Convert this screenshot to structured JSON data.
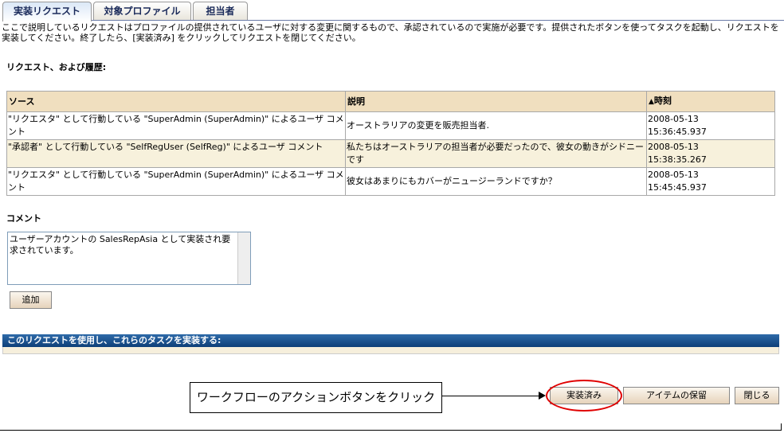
{
  "tabs": [
    {
      "label": "実装リクエスト"
    },
    {
      "label": "対象プロファイル"
    },
    {
      "label": "担当者"
    }
  ],
  "description": "ここで説明しているリクエストはプロファイルの提供されているユーザに対する変更に関するもので、承認されているので実施が必要です。提供されたボタンを使ってタスクを起動し、リクエストを実装してください。終了したら、[実装済み] をクリックしてリクエストを閉じてください。",
  "history_heading": "リクエスト、および履歴:",
  "table": {
    "headers": [
      "ソース",
      "説明",
      "時刻"
    ],
    "sort_icon": "▲",
    "rows": [
      {
        "source": "\"リクエスタ\" として行動している \"SuperAdmin (SuperAdmin)\" によるユーザ コメント",
        "desc": "オーストラリアの変更を販売担当者.",
        "date": "2008-05-13",
        "time": "15:36:45.937"
      },
      {
        "source": "\"承認者\" として行動している \"SelfRegUser (SelfReg)\" によるユーザ コメント",
        "desc": "私たちはオーストラリアの担当者が必要だったので、彼女の動きがシドニーです",
        "date": "2008-05-13",
        "time": "15:38:35.267"
      },
      {
        "source": "\"リクエスタ\" として行動している \"SuperAdmin (SuperAdmin)\" によるユーザ コメント",
        "desc": "彼女はあまりにもカバーがニュージーランドですか？",
        "date": "2008-05-13",
        "time": "15:45:45.937"
      }
    ]
  },
  "comment": {
    "label": "コメント",
    "value": "ユーザーアカウントの SalesRepAsia として実装され要求されています。",
    "add_label": "追加"
  },
  "tasks_bar": "このリクエストを使用し、これらのタスクを実装する:",
  "callout": "ワークフローのアクションボタンをクリック",
  "buttons": {
    "done": "実装済み",
    "hold": "アイテムの保留",
    "close": "閉じる"
  },
  "colors": {
    "highlight": "#e00000",
    "bar": "#0e3f78",
    "header": "#f0dfbf"
  }
}
